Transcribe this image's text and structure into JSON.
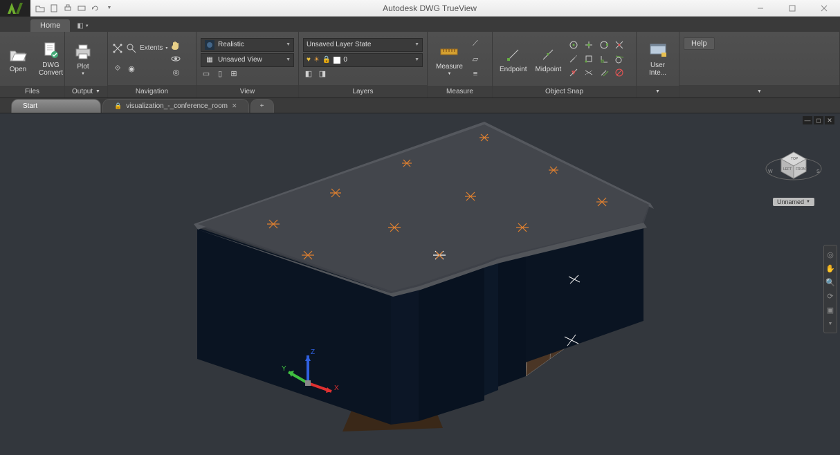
{
  "app": {
    "title": "Autodesk DWG TrueView"
  },
  "qat": [
    "open",
    "save",
    "print",
    "print2",
    "arrow"
  ],
  "tabs": {
    "home": "Home"
  },
  "ribbon": {
    "files": {
      "title": "Files",
      "open": "Open",
      "convert": "DWG\nConvert"
    },
    "output": {
      "title": "Output",
      "plot": "Plot"
    },
    "navigation": {
      "title": "Navigation",
      "extents": "Extents"
    },
    "view": {
      "title": "View",
      "visual_style": "Realistic",
      "saved_view": "Unsaved View"
    },
    "layers": {
      "title": "Layers",
      "state": "Unsaved Layer State",
      "current": "0"
    },
    "measure": {
      "title": "Measure",
      "btn": "Measure"
    },
    "osnap": {
      "title": "Object Snap",
      "endpoint": "Endpoint",
      "midpoint": "Midpoint"
    },
    "ui": {
      "btn": "User Inte..."
    },
    "help": {
      "btn": "Help"
    }
  },
  "doctabs": {
    "start": "Start",
    "file": "visualization_-_conference_room"
  },
  "viewcube": {
    "top": "TOP",
    "left": "LEFT",
    "front": "FRONT",
    "w": "W",
    "s": "S",
    "label": "Unnamed"
  },
  "axes": {
    "x": "X",
    "y": "Y",
    "z": "Z"
  }
}
